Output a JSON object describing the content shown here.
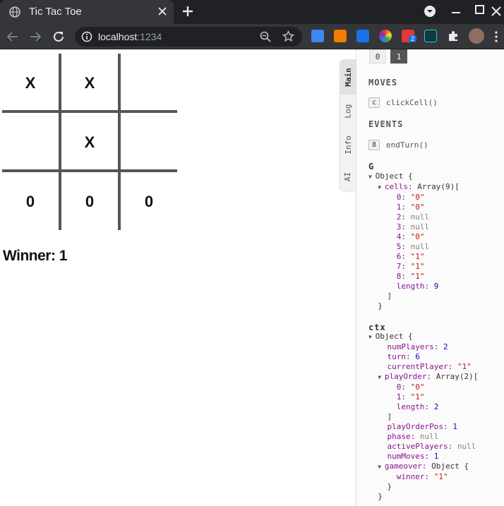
{
  "browser": {
    "tab_title": "Tic Tac Toe",
    "url_host": "localhost",
    "url_port": ":1234",
    "ext_badge": "2"
  },
  "game": {
    "cells": [
      "X",
      "X",
      "",
      "",
      "X",
      "",
      "0",
      "0",
      "0"
    ],
    "winner_text": "Winner: 1"
  },
  "debug": {
    "side_tabs": [
      "Main",
      "Log",
      "Info",
      "AI"
    ],
    "players": [
      "0",
      "1"
    ],
    "moves_heading": "MOVES",
    "move_key": "c",
    "move_fn": "clickCell()",
    "events_heading": "EVENTS",
    "event_key": "8",
    "event_fn": "endTurn()",
    "g_heading": "G",
    "ctx_heading": "ctx",
    "G": {
      "cells": [
        "\"0\"",
        "\"0\"",
        "null",
        "null",
        "\"0\"",
        "null",
        "\"1\"",
        "\"1\"",
        "\"1\""
      ],
      "length": "9"
    },
    "ctx": {
      "numPlayers": "2",
      "turn": "6",
      "currentPlayer": "\"1\"",
      "playOrder": [
        "\"0\"",
        "\"1\""
      ],
      "playOrderLength": "2",
      "playOrderPos": "1",
      "phase": "null",
      "activePlayers": "null",
      "numMoves": "1",
      "gameover_winner": "\"1\""
    }
  }
}
